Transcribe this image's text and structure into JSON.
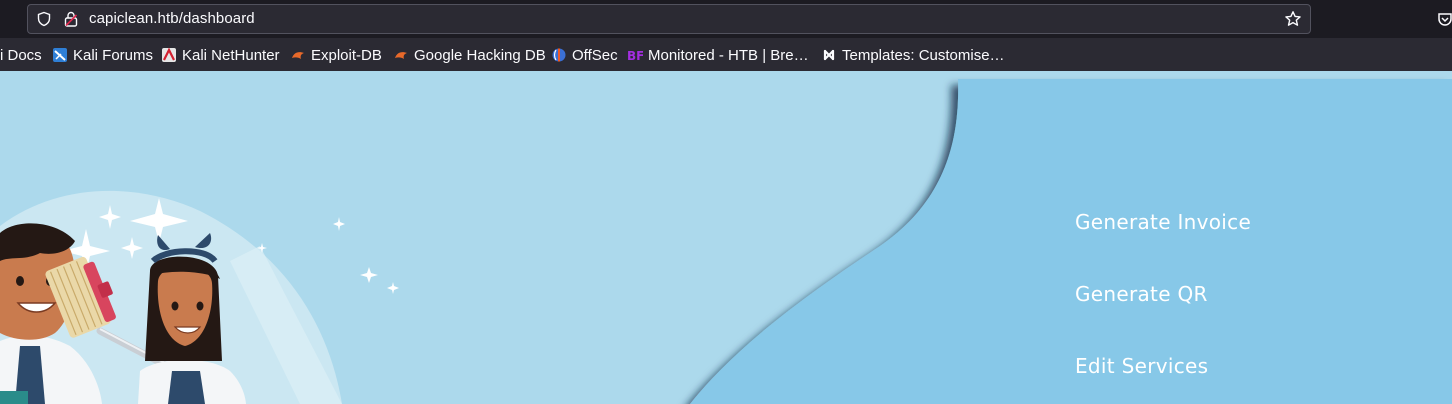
{
  "browser": {
    "url": "capiclean.htb/dashboard",
    "bookmarks": [
      {
        "label": "i Docs",
        "icon": "kali-docs-icon"
      },
      {
        "label": "Kali Forums",
        "icon": "kali-forums-icon"
      },
      {
        "label": "Kali NetHunter",
        "icon": "kali-nethunter-icon"
      },
      {
        "label": "Exploit-DB",
        "icon": "exploit-db-icon"
      },
      {
        "label": "Google Hacking DB",
        "icon": "google-hacking-db-icon"
      },
      {
        "label": "OffSec",
        "icon": "offsec-icon"
      },
      {
        "label": "Monitored - HTB | Bre…",
        "icon": "bf-icon"
      },
      {
        "label": "Templates: Customise…",
        "icon": "joomla-icon"
      }
    ]
  },
  "nav": {
    "items": [
      {
        "label": "Generate Invoice"
      },
      {
        "label": "Generate QR"
      },
      {
        "label": "Edit Services"
      }
    ]
  },
  "colors": {
    "page_bg": "#acd9ec",
    "panel_bg": "#87c8e8",
    "nav_text": "#ffffff"
  }
}
